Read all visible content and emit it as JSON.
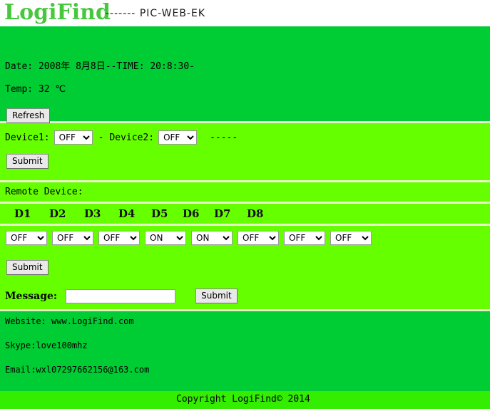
{
  "header": {
    "logo": "LogiFind",
    "subtitle": "------- PIC-WEB-EK"
  },
  "status": {
    "datetime_line": "Date: 2008年 8月8日--TIME: 20:8:30-",
    "temp_line": "Temp: 32 ℃",
    "refresh_label": "Refresh"
  },
  "devices": {
    "device1_label": "Device1:",
    "device1_value": "OFF",
    "middle_dash": "-",
    "device2_label": "Device2:",
    "device2_value": "OFF",
    "trailing_dashes": "-----",
    "submit_label": "Submit",
    "options": [
      "OFF",
      "ON"
    ]
  },
  "remote": {
    "title": "Remote Device:",
    "columns": [
      "D1",
      "D2",
      "D3",
      "D4",
      "D5",
      "D6",
      "D7",
      "D8"
    ],
    "values": [
      "OFF",
      "OFF",
      "OFF",
      "ON",
      "ON",
      "OFF",
      "OFF",
      "OFF"
    ],
    "options": [
      "OFF",
      "ON"
    ],
    "submit_label": "Submit"
  },
  "message": {
    "label": "Message:",
    "value": "",
    "placeholder": "",
    "submit_label": "Submit"
  },
  "footer": {
    "website": "Website: www.LogiFind.com",
    "skype": "Skype:love100mhz",
    "email": "Email:wxl07297662156@163.com",
    "copyright": "Copyright LogiFind© 2014"
  },
  "colors": {
    "panel_dark_green": "#00cc33",
    "panel_light_green": "#66ff00",
    "copyright_green": "#33ee00",
    "logo_green": "#46c83c",
    "separator": "#e8f5c8"
  }
}
